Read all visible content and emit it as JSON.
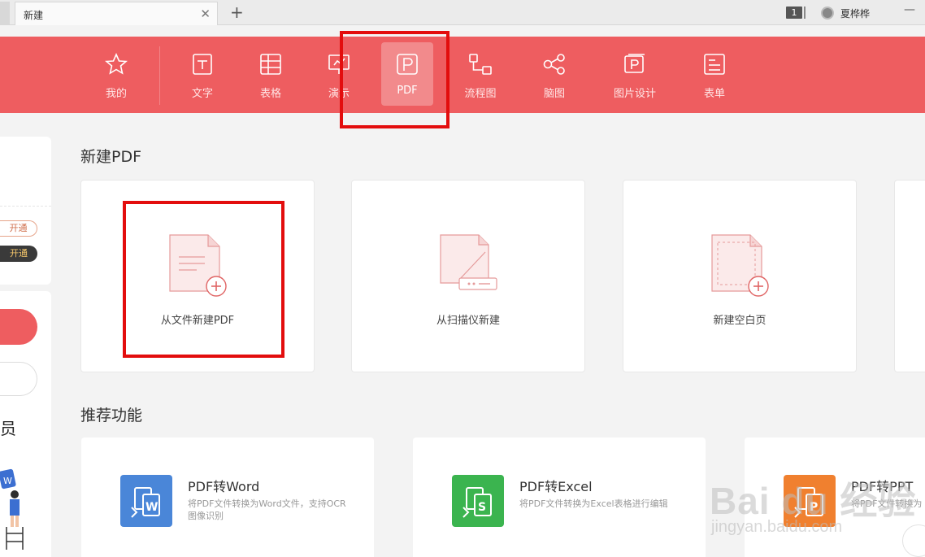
{
  "titlebar": {
    "tab_label": "新建",
    "tab_close": "✕",
    "new_tab": "+",
    "count_badge": "1",
    "user_name": "夏桦桦",
    "minimize": "—"
  },
  "toolbar": {
    "items": [
      {
        "label": "我的",
        "icon": "star-icon"
      },
      {
        "label": "文字",
        "icon": "document-icon"
      },
      {
        "label": "表格",
        "icon": "table-icon"
      },
      {
        "label": "演示",
        "icon": "presentation-icon"
      },
      {
        "label": "PDF",
        "icon": "pdf-icon",
        "active": true
      },
      {
        "label": "流程图",
        "icon": "flowchart-icon"
      },
      {
        "label": "脑图",
        "icon": "mindmap-icon"
      },
      {
        "label": "图片设计",
        "icon": "image-design-icon"
      },
      {
        "label": "表单",
        "icon": "form-icon"
      }
    ],
    "accent": "#ee5d60"
  },
  "left_panel": {
    "open_outline": "开通",
    "open_dark": "开通",
    "partial_char": "员"
  },
  "new_pdf": {
    "title": "新建PDF",
    "cards": [
      {
        "label": "从文件新建PDF",
        "icon": "file-add-icon"
      },
      {
        "label": "从扫描仪新建",
        "icon": "scanner-icon"
      },
      {
        "label": "新建空白页",
        "icon": "blank-page-add-icon"
      }
    ]
  },
  "recommended": {
    "title": "推荐功能",
    "items": [
      {
        "title": "PDF转Word",
        "desc": "将PDF文件转换为Word文件，支持OCR图像识别",
        "color": "#4a86d8"
      },
      {
        "title": "PDF转Excel",
        "desc": "将PDF文件转换为Excel表格进行编辑",
        "color": "#3bb44f"
      },
      {
        "title": "PDF转PPT",
        "desc": "将PDF文件转换为",
        "color": "#f0802f"
      }
    ]
  },
  "watermark": {
    "main": "Bai du 经验",
    "sub": "jingyan.baidu.com"
  }
}
